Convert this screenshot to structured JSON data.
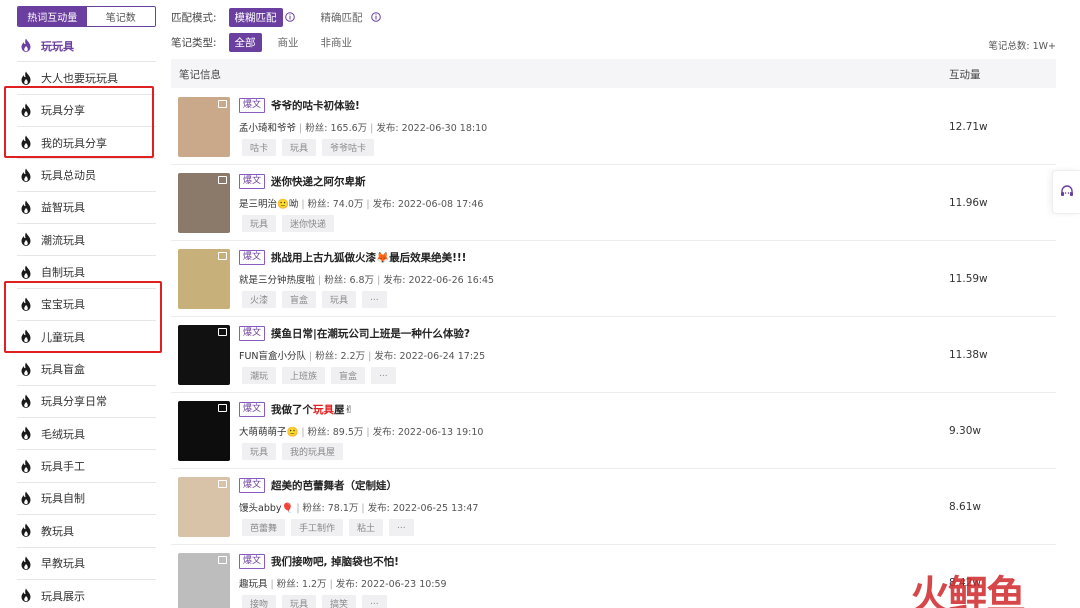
{
  "sidebar": {
    "tabs": [
      {
        "label": "热词互动量",
        "active": true
      },
      {
        "label": "笔记数",
        "active": false
      }
    ],
    "items": [
      {
        "label": "玩玩具",
        "active": true
      },
      {
        "label": "大人也要玩玩具",
        "active": false
      },
      {
        "label": "玩具分享",
        "active": false
      },
      {
        "label": "我的玩具分享",
        "active": false
      },
      {
        "label": "玩具总动员",
        "active": false
      },
      {
        "label": "益智玩具",
        "active": false
      },
      {
        "label": "潮流玩具",
        "active": false
      },
      {
        "label": "自制玩具",
        "active": false
      },
      {
        "label": "宝宝玩具",
        "active": false
      },
      {
        "label": "儿童玩具",
        "active": false
      },
      {
        "label": "玩具盲盒",
        "active": false
      },
      {
        "label": "玩具分享日常",
        "active": false
      },
      {
        "label": "毛绒玩具",
        "active": false
      },
      {
        "label": "玩具手工",
        "active": false
      },
      {
        "label": "玩具自制",
        "active": false
      },
      {
        "label": "教玩具",
        "active": false
      },
      {
        "label": "早教玩具",
        "active": false
      },
      {
        "label": "玩具展示",
        "active": false
      }
    ],
    "fire_icon": "fire-icon",
    "accent_color": "#6b3fa0",
    "annotation_color": "#e02020"
  },
  "filters": {
    "match_mode": {
      "label": "匹配模式:",
      "options": [
        {
          "label": "模糊匹配",
          "active": true
        },
        {
          "label": "精确匹配",
          "active": false
        }
      ]
    },
    "note_type": {
      "label": "笔记类型:",
      "options": [
        {
          "label": "全部",
          "active": true
        },
        {
          "label": "商业",
          "active": false
        },
        {
          "label": "非商业",
          "active": false
        }
      ]
    },
    "total": "笔记总数: 1W+"
  },
  "table": {
    "headers": {
      "info": "笔记信息",
      "metric": "互动量"
    },
    "rows": [
      {
        "badge": "爆文",
        "title": "爷爷的咕卡初体验!",
        "title_pre": "",
        "title_hl": "",
        "title_post": "",
        "author": "孟小琦和爷爷",
        "fans": "粉丝: 165.6万",
        "publish": "发布: 2022-06-30 18:10",
        "tags": [
          "咕卡",
          "玩具",
          "爷爷咕卡"
        ],
        "metric": "12.71w",
        "thumb": "#c9a98a"
      },
      {
        "badge": "爆文",
        "title": "迷你快递之阿尔卑斯",
        "title_pre": "",
        "title_hl": "",
        "title_post": "",
        "author": "是三明治🙂呦",
        "fans": "粉丝: 74.0万",
        "publish": "发布: 2022-06-08 17:46",
        "tags": [
          "玩具",
          "迷你快递"
        ],
        "metric": "11.96w",
        "thumb": "#8b7a6a"
      },
      {
        "badge": "爆文",
        "title": "挑战用上古九狐做火漆🦊最后效果绝美!!!",
        "title_pre": "",
        "title_hl": "",
        "title_post": "",
        "author": "就是三分钟热度啦",
        "fans": "粉丝: 6.8万",
        "publish": "发布: 2022-06-26 16:45",
        "tags": [
          "火漆",
          "盲盒",
          "玩具",
          "..."
        ],
        "metric": "11.59w",
        "thumb": "#c7b07a"
      },
      {
        "badge": "爆文",
        "title": "摸鱼日常|在潮玩公司上班是一种什么体验?",
        "title_pre": "",
        "title_hl": "",
        "title_post": "",
        "author": "FUN盲盒小分队",
        "fans": "粉丝: 2.2万",
        "publish": "发布: 2022-06-24 17:25",
        "tags": [
          "潮玩",
          "上班族",
          "盲盒",
          "..."
        ],
        "metric": "11.38w",
        "thumb": "#111111"
      },
      {
        "badge": "爆文",
        "title": "我做了个玩具屋✌",
        "title_pre": "我做了个",
        "title_hl": "玩具",
        "title_post": "屋✌",
        "author": "大萌萌萌子🙂",
        "fans": "粉丝: 89.5万",
        "publish": "发布: 2022-06-13 19:10",
        "tags": [
          "玩具",
          "我的玩具屋"
        ],
        "metric": "9.30w",
        "thumb": "#0d0d0d"
      },
      {
        "badge": "爆文",
        "title": "超美的芭蕾舞者（定制娃）",
        "title_pre": "",
        "title_hl": "",
        "title_post": "",
        "author": "馒头abby🎈",
        "fans": "粉丝: 78.1万",
        "publish": "发布: 2022-06-25 13:47",
        "tags": [
          "芭蕾舞",
          "手工制作",
          "粘土",
          "..."
        ],
        "metric": "8.61w",
        "thumb": "#d8c3a8"
      },
      {
        "badge": "爆文",
        "title": "我们接吻吧, 掉脑袋也不怕!",
        "title_pre": "",
        "title_hl": "",
        "title_post": "",
        "author": "趣玩具",
        "fans": "粉丝: 1.2万",
        "publish": "发布: 2022-06-23 10:59",
        "tags": [
          "接吻",
          "玩具",
          "搞笑",
          "..."
        ],
        "metric": "8.42w",
        "thumb": "#bdbdbd"
      }
    ]
  },
  "float_button": {
    "icon": "customer-service-icon"
  },
  "watermark": "火鲤鱼"
}
